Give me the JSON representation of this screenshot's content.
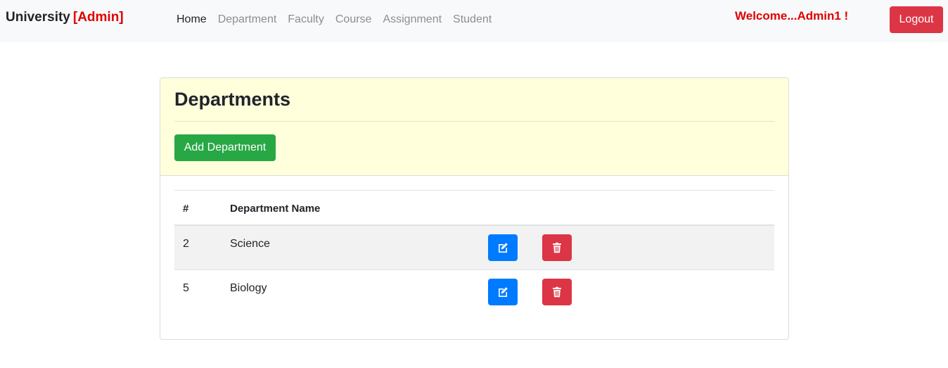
{
  "navbar": {
    "brand": "University",
    "role": "[Admin]",
    "links": [
      {
        "label": "Home",
        "active": true
      },
      {
        "label": "Department",
        "active": false
      },
      {
        "label": "Faculty",
        "active": false
      },
      {
        "label": "Course",
        "active": false
      },
      {
        "label": "Assignment",
        "active": false
      },
      {
        "label": "Student",
        "active": false
      }
    ],
    "welcome": "Welcome...Admin1 !",
    "logout_label": "Logout"
  },
  "page": {
    "title": "Departments",
    "add_button_label": "Add Department"
  },
  "table": {
    "headers": [
      "#",
      "Department Name"
    ],
    "rows": [
      {
        "id": "2",
        "name": "Science",
        "edit_icon": "edit-icon",
        "delete_icon": "trash-icon"
      },
      {
        "id": "5",
        "name": "Biology",
        "edit_icon": "edit-icon",
        "delete_icon": "trash-icon"
      }
    ]
  },
  "colors": {
    "navbar_bg": "#f8f9fa",
    "accent_red": "#e00000",
    "danger": "#dc3545",
    "success": "#28a745",
    "primary": "#007bff",
    "card_header_bg": "#ffffdc"
  }
}
